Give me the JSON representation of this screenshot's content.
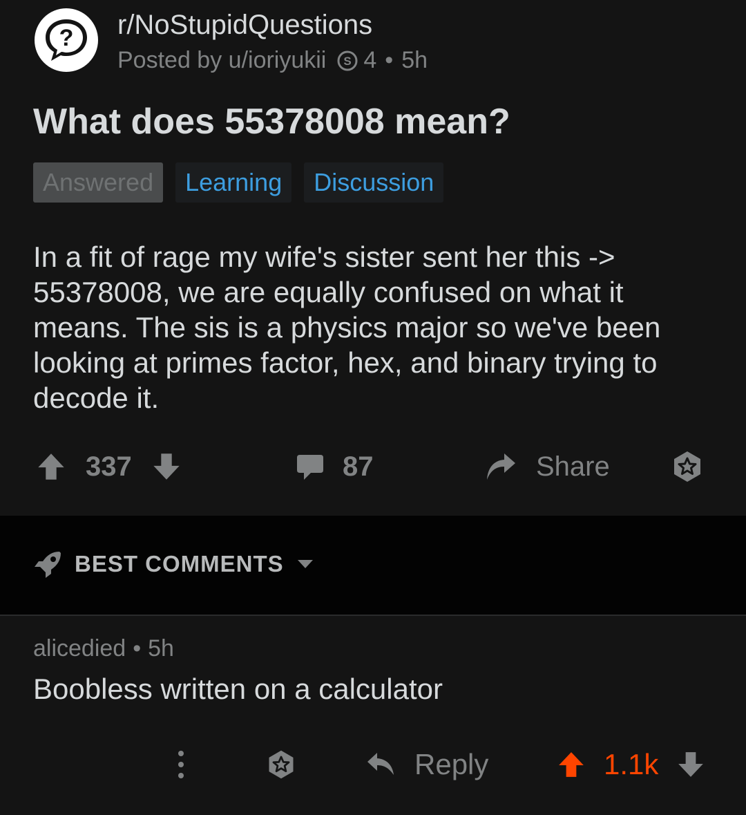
{
  "post": {
    "subreddit": "r/NoStupidQuestions",
    "posted_by": "Posted by u/ioriyukii",
    "karma": "4",
    "age": "5h",
    "title": "What does 55378008 mean?",
    "flairs": [
      "Answered",
      "Learning",
      "Discussion"
    ],
    "body": "In a fit of rage my wife's sister sent her this -> 55378008, we are equally confused on what it means. The sis is a physics major so we've been looking at primes factor, hex, and binary trying to decode it.",
    "upvotes": "337",
    "comment_count": "87",
    "share_label": "Share"
  },
  "sort": {
    "label": "BEST COMMENTS"
  },
  "comment": {
    "author": "alicedied",
    "age": "5h",
    "body": "Boobless written on a calculator",
    "reply_label": "Reply",
    "score": "1.1k"
  },
  "icons": {
    "subreddit": "question-bubble-icon",
    "karma": "snoo-coin-icon",
    "upvote": "arrow-up-icon",
    "downvote": "arrow-down-icon",
    "comment": "speech-bubble-icon",
    "share": "share-arrow-icon",
    "award": "award-star-icon",
    "sort": "rocket-icon",
    "more": "vertical-dots-icon",
    "reply": "reply-arrow-icon"
  },
  "colors": {
    "background": "#141414",
    "sort_bar": "#030303",
    "text": "#d7dadc",
    "muted": "#818384",
    "flair_blue": "#3d9ee0",
    "upvoted": "#ff4500"
  }
}
